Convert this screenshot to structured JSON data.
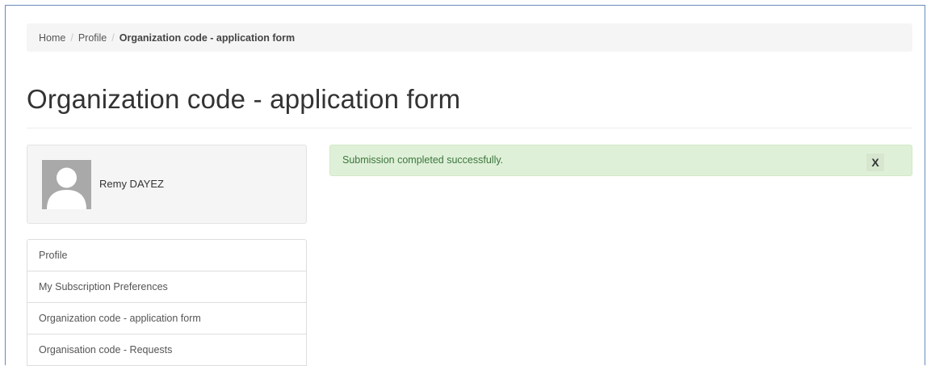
{
  "breadcrumb": {
    "items": [
      {
        "label": "Home"
      },
      {
        "label": "Profile"
      }
    ],
    "separator": "/",
    "current": "Organization code - application form"
  },
  "page": {
    "title": "Organization code - application form"
  },
  "profile": {
    "name": "Remy DAYEZ",
    "avatar_icon": "default-user-avatar-icon"
  },
  "nav": {
    "items": [
      {
        "label": "Profile"
      },
      {
        "label": "My Subscription Preferences"
      },
      {
        "label": "Organization code - application form"
      },
      {
        "label": "Organisation code - Requests"
      }
    ]
  },
  "alert": {
    "message": "Submission completed successfully.",
    "close_label": "X",
    "color": "#3c763d",
    "background": "#dff0d8"
  }
}
